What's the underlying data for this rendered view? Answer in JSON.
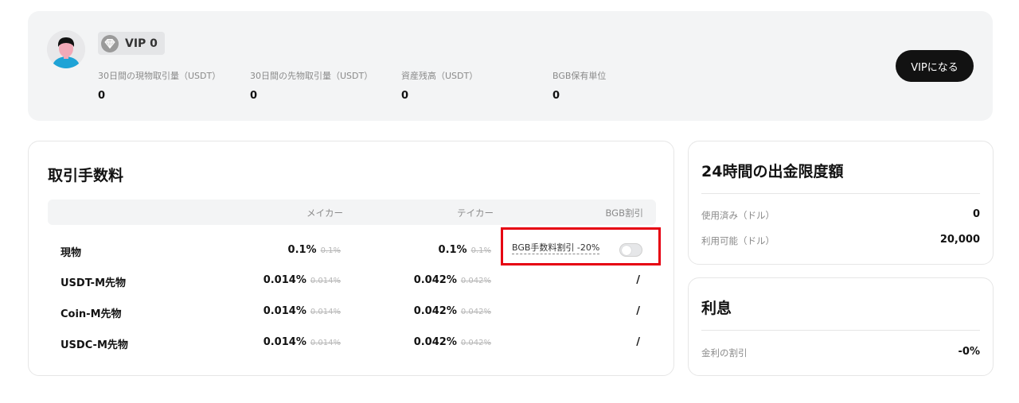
{
  "vip": {
    "level": "VIP 0",
    "stats": [
      {
        "label": "30日間の現物取引量（USDT）",
        "value": "0"
      },
      {
        "label": "30日間の先物取引量（USDT）",
        "value": "0"
      },
      {
        "label": "資産残高（USDT）",
        "value": "0"
      },
      {
        "label": "BGB保有単位",
        "value": "0"
      }
    ],
    "button_label": "VIPになる"
  },
  "fees": {
    "title": "取引手数料",
    "headers": {
      "maker": "メイカー",
      "taker": "テイカー",
      "bgb": "BGB割引"
    },
    "rows": [
      {
        "market": "現物",
        "maker": "0.1%",
        "maker_old": "0.1%",
        "taker": "0.1%",
        "taker_old": "0.1%",
        "bgb": ""
      },
      {
        "market": "USDT-M先物",
        "maker": "0.014%",
        "maker_old": "0.014%",
        "taker": "0.042%",
        "taker_old": "0.042%",
        "bgb": "/"
      },
      {
        "market": "Coin-M先物",
        "maker": "0.014%",
        "maker_old": "0.014%",
        "taker": "0.042%",
        "taker_old": "0.042%",
        "bgb": "/"
      },
      {
        "market": "USDC-M先物",
        "maker": "0.014%",
        "maker_old": "0.014%",
        "taker": "0.042%",
        "taker_old": "0.042%",
        "bgb": "/"
      }
    ],
    "bgb_discount": {
      "label": "BGB手数料割引 -20%",
      "enabled": false
    },
    "highlight_color": "#e60012"
  },
  "withdrawal": {
    "title": "24時間の出金限度額",
    "used_label": "使用済み（ドル）",
    "used_value": "0",
    "available_label": "利用可能（ドル）",
    "available_value": "20,000"
  },
  "interest": {
    "title": "利息",
    "rate_label": "金利の割引",
    "rate_value": "-0%"
  }
}
